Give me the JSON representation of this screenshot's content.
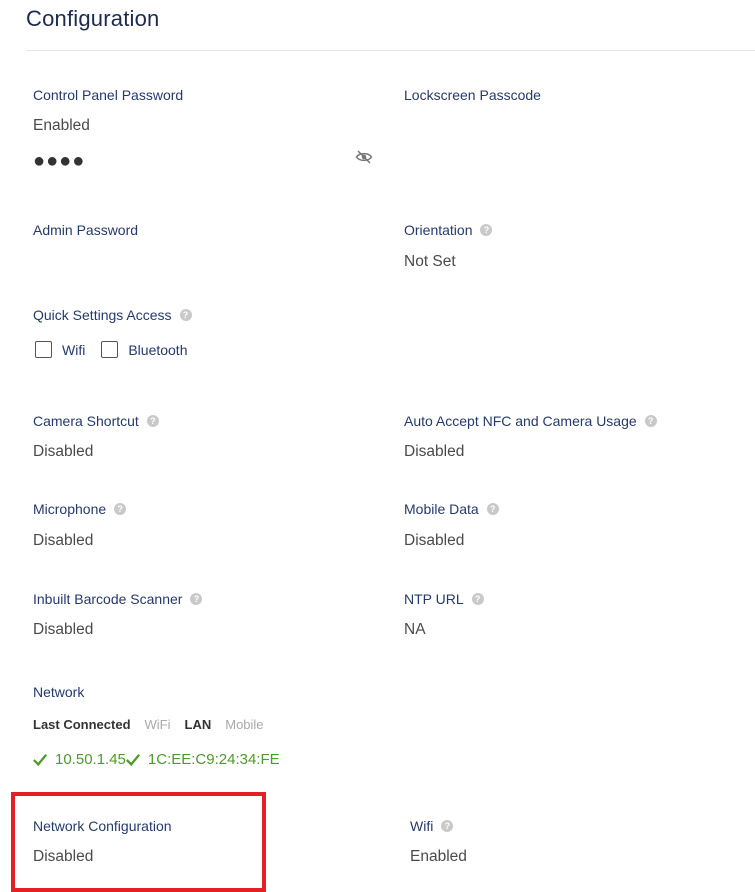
{
  "page": {
    "title": "Configuration"
  },
  "fields": {
    "control_panel_password": {
      "label": "Control Panel Password",
      "value": "Enabled",
      "masked": "●●●●"
    },
    "lockscreen_passcode": {
      "label": "Lockscreen Passcode"
    },
    "admin_password": {
      "label": "Admin Password"
    },
    "orientation": {
      "label": "Orientation",
      "value": "Not Set"
    },
    "quick_settings": {
      "label": "Quick Settings Access",
      "options": [
        {
          "label": "Wifi",
          "checked": false
        },
        {
          "label": "Bluetooth",
          "checked": false
        }
      ]
    },
    "camera_shortcut": {
      "label": "Camera Shortcut",
      "value": "Disabled"
    },
    "auto_accept_nfc": {
      "label": "Auto Accept NFC and Camera Usage",
      "value": "Disabled"
    },
    "microphone": {
      "label": "Microphone",
      "value": "Disabled"
    },
    "mobile_data": {
      "label": "Mobile Data",
      "value": "Disabled"
    },
    "barcode_scanner": {
      "label": "Inbuilt Barcode Scanner",
      "value": "Disabled"
    },
    "ntp_url": {
      "label": "NTP URL",
      "value": "NA"
    },
    "network": {
      "label": "Network",
      "tabs": [
        "Last Connected",
        "WiFi",
        "LAN",
        "Mobile"
      ],
      "ip": "10.50.1.45",
      "mac": "1C:EE:C9:24:34:FE"
    },
    "network_configuration": {
      "label": "Network Configuration",
      "value": "Disabled"
    },
    "wifi": {
      "label": "Wifi",
      "value": "Enabled"
    }
  },
  "icons": {
    "help": "help-circle-icon",
    "eye": "eye-off-icon",
    "check": "check-icon"
  },
  "colors": {
    "label": "#253a6a",
    "title": "#1b2a4e",
    "success": "#4e9a2a",
    "highlight": "#e41f26"
  }
}
